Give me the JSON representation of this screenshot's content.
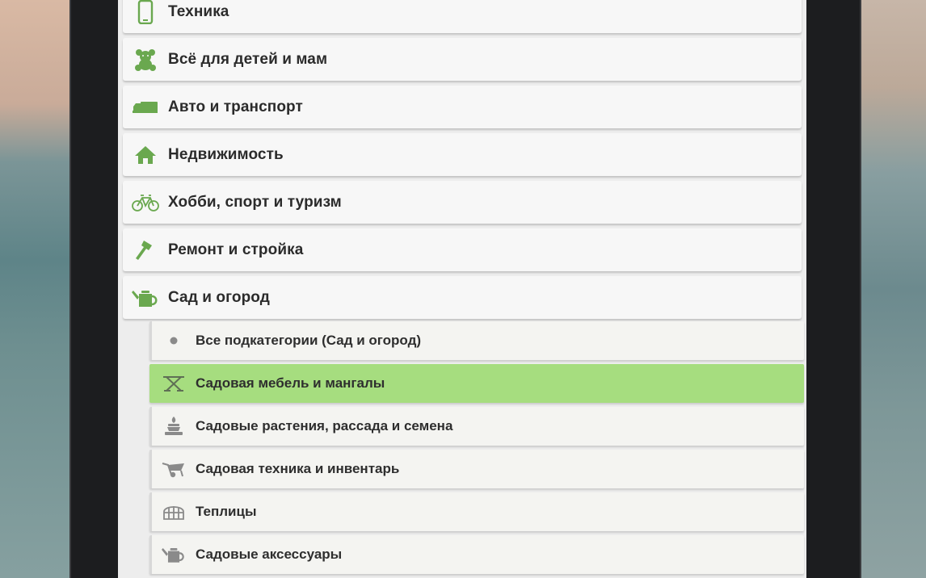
{
  "categories": [
    {
      "label": "Техника",
      "icon": "phone-icon"
    },
    {
      "label": "Всё для детей и мам",
      "icon": "teddy-bear-icon"
    },
    {
      "label": "Авто и транспорт",
      "icon": "truck-icon"
    },
    {
      "label": "Недвижимость",
      "icon": "house-icon"
    },
    {
      "label": "Хобби, спорт и туризм",
      "icon": "bicycle-icon"
    },
    {
      "label": "Ремонт и стройка",
      "icon": "hammer-icon"
    },
    {
      "label": "Сад и огород",
      "icon": "watering-can-icon"
    }
  ],
  "subcategories": [
    {
      "label": "Все подкатегории (Сад и огород)",
      "icon": "dot-icon"
    },
    {
      "label": "Садовая мебель и мангалы",
      "icon": "garden-table-icon",
      "selected": true
    },
    {
      "label": "Садовые растения, рассада и семена",
      "icon": "plant-pot-icon"
    },
    {
      "label": "Садовая техника и инвентарь",
      "icon": "wheelbarrow-icon"
    },
    {
      "label": "Теплицы",
      "icon": "greenhouse-icon"
    },
    {
      "label": "Садовые аксессуары",
      "icon": "watering-can-small-icon"
    }
  ],
  "colors": {
    "accent_green": "#6aa84f",
    "selected_bg": "#a6dd7f",
    "sub_icon_gray": "#8a8a8a"
  }
}
